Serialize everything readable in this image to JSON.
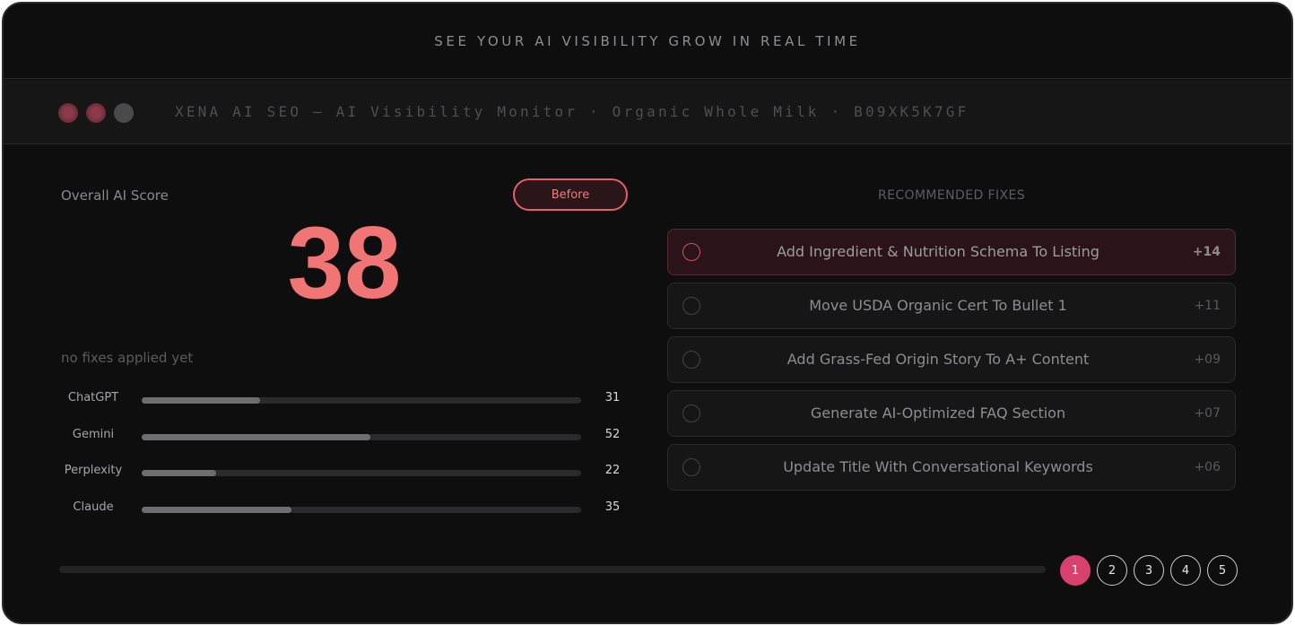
{
  "banner": {
    "text": "SEE YOUR AI VISIBILITY GROW IN REAL TIME"
  },
  "window": {
    "title": "XENA AI SEO — AI Visibility Monitor · Organic Whole Milk · B09XK5K7GF"
  },
  "score": {
    "label": "Overall AI Score",
    "value": "38",
    "toggle_label": "Before",
    "status": "no fixes applied yet",
    "color": "#f27575"
  },
  "models": [
    {
      "name": "ChatGPT",
      "value": "31",
      "level": 0.27
    },
    {
      "name": "Gemini",
      "value": "52",
      "level": 0.52
    },
    {
      "name": "Perplexity",
      "value": "22",
      "level": 0.17
    },
    {
      "name": "Claude",
      "value": "35",
      "level": 0.34
    }
  ],
  "fixes": {
    "title": "RECOMMENDED FIXES",
    "items": [
      {
        "label": "Add Ingredient & Nutrition Schema To Listing",
        "points": "+14",
        "active": true
      },
      {
        "label": "Move USDA Organic Cert To Bullet 1",
        "points": "+11",
        "active": false
      },
      {
        "label": "Add Grass-Fed Origin Story To A+ Content",
        "points": "+09",
        "active": false
      },
      {
        "label": "Generate AI-Optimized FAQ Section",
        "points": "+07",
        "active": false
      },
      {
        "label": "Update Title With Conversational Keywords",
        "points": "+06",
        "active": false
      }
    ]
  },
  "pagination": {
    "progress": 0,
    "pages": [
      "1",
      "2",
      "3",
      "4",
      "5"
    ],
    "current": "1",
    "accent": "#d8406e"
  }
}
